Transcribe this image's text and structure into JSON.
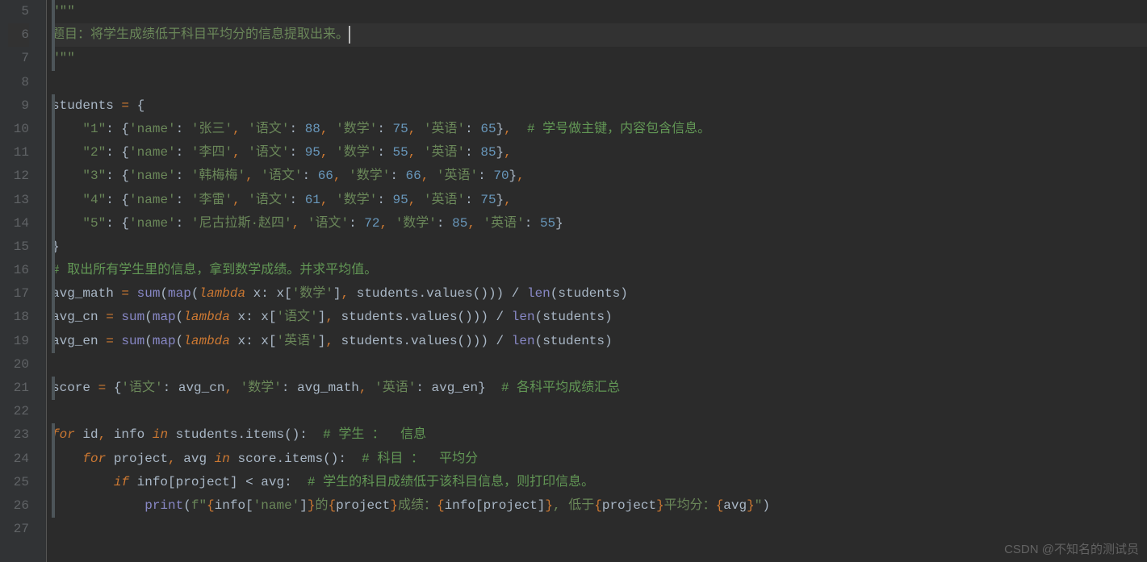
{
  "lines": {
    "start": 5,
    "end": 27,
    "current": 6
  },
  "code": {
    "l5": "\"\"\"",
    "l6": "题目：将学生成绩低于科目平均分的信息提取出来。",
    "l7": "\"\"\"",
    "l9_var": "students ",
    "l9_eq": "=",
    "l9_brace": " {",
    "l10_k": "\"1\"",
    "l10_name_k": "'name'",
    "l10_name_v": "'张三'",
    "l10_yw_k": "'语文'",
    "l10_yw_v": "88",
    "l10_sx_k": "'数学'",
    "l10_sx_v": "75",
    "l10_yy_k": "'英语'",
    "l10_yy_v": "65",
    "l10_cmt": "# 学号做主键，内容包含信息。",
    "l11_k": "\"2\"",
    "l11_name_v": "'李四'",
    "l11_yw_v": "95",
    "l11_sx_v": "55",
    "l11_yy_v": "85",
    "l12_k": "\"3\"",
    "l12_name_v": "'韩梅梅'",
    "l12_yw_v": "66",
    "l12_sx_v": "66",
    "l12_yy_v": "70",
    "l13_k": "\"4\"",
    "l13_name_v": "'李雷'",
    "l13_yw_v": "61",
    "l13_sx_v": "95",
    "l13_yy_v": "75",
    "l14_k": "\"5\"",
    "l14_name_v": "'尼古拉斯·赵四'",
    "l14_yw_v": "72",
    "l14_sx_v": "85",
    "l14_yy_v": "55",
    "l16_cmt": "# 取出所有学生里的信息，拿到数学成绩。并求平均值。",
    "l17_var": "avg_math ",
    "l17_key": "'数学'",
    "l18_var": "avg_cn ",
    "l18_key": "'语文'",
    "l19_var": "avg_en ",
    "l19_key": "'英语'",
    "sum": "sum",
    "map": "map",
    "lambda": "lambda",
    "len": "len",
    "values": "values",
    "items": "items",
    "students": "students",
    "l21_var": "score ",
    "l21_k1": "'语文'",
    "l21_v1": "avg_cn",
    "l21_k2": "'数学'",
    "l21_v2": "avg_math",
    "l21_k3": "'英语'",
    "l21_v3": "avg_en",
    "l21_cmt": "# 各科平均成绩汇总",
    "for": "for",
    "in": "in",
    "if": "if",
    "l23_id": "id",
    "l23_info": "info",
    "l23_cmt": "# 学生 ：  信息",
    "l24_proj": "project",
    "l24_avg": "avg",
    "l24_score": "score",
    "l24_cmt": "# 科目 ：  平均分",
    "l25_info": "info",
    "l25_proj": "project",
    "l25_avg": "avg",
    "l25_cmt": "# 学生的科目成绩低于该科目信息，则打印信息。",
    "print": "print",
    "l26_f1": "\"",
    "l26_t1": "的",
    "l26_t2": "成绩：",
    "l26_t3": ", 低于",
    "l26_t4": "平均分：",
    "l26_name": "'name'"
  },
  "watermark": "CSDN @不知名的测试员"
}
